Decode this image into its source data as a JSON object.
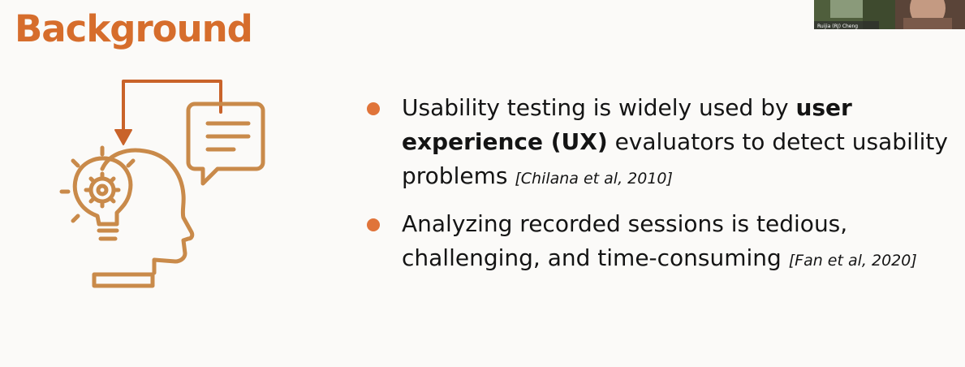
{
  "slide": {
    "title": "Background",
    "accent_color": "#d66d2c",
    "bullet_color": "#e0743a"
  },
  "video_thumbnail": {
    "caption": "Ruijia (RJ) Cheng"
  },
  "illustration": {
    "icon": "head-with-lightbulb-gear-and-speech-bubble-icon"
  },
  "bullets": [
    {
      "pre": "Usability testing is widely used by ",
      "bold": "user experience (UX)",
      "post": " evaluators to detect usability problems ",
      "citation": "[Chilana et al, 2010]"
    },
    {
      "pre": "Analyzing recorded sessions is tedious, challenging, and time-consuming ",
      "citation": "[Fan et al, 2020]"
    }
  ]
}
